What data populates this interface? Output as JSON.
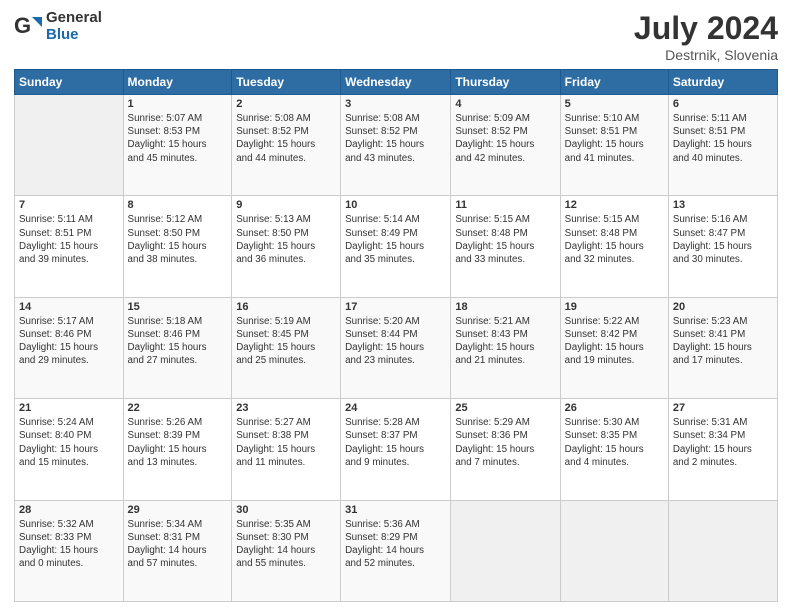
{
  "header": {
    "logo_general": "General",
    "logo_blue": "Blue",
    "month_year": "July 2024",
    "location": "Destrnik, Slovenia"
  },
  "days_of_week": [
    "Sunday",
    "Monday",
    "Tuesday",
    "Wednesday",
    "Thursday",
    "Friday",
    "Saturday"
  ],
  "weeks": [
    [
      {
        "day": "",
        "info": ""
      },
      {
        "day": "1",
        "info": "Sunrise: 5:07 AM\nSunset: 8:53 PM\nDaylight: 15 hours\nand 45 minutes."
      },
      {
        "day": "2",
        "info": "Sunrise: 5:08 AM\nSunset: 8:52 PM\nDaylight: 15 hours\nand 44 minutes."
      },
      {
        "day": "3",
        "info": "Sunrise: 5:08 AM\nSunset: 8:52 PM\nDaylight: 15 hours\nand 43 minutes."
      },
      {
        "day": "4",
        "info": "Sunrise: 5:09 AM\nSunset: 8:52 PM\nDaylight: 15 hours\nand 42 minutes."
      },
      {
        "day": "5",
        "info": "Sunrise: 5:10 AM\nSunset: 8:51 PM\nDaylight: 15 hours\nand 41 minutes."
      },
      {
        "day": "6",
        "info": "Sunrise: 5:11 AM\nSunset: 8:51 PM\nDaylight: 15 hours\nand 40 minutes."
      }
    ],
    [
      {
        "day": "7",
        "info": "Sunrise: 5:11 AM\nSunset: 8:51 PM\nDaylight: 15 hours\nand 39 minutes."
      },
      {
        "day": "8",
        "info": "Sunrise: 5:12 AM\nSunset: 8:50 PM\nDaylight: 15 hours\nand 38 minutes."
      },
      {
        "day": "9",
        "info": "Sunrise: 5:13 AM\nSunset: 8:50 PM\nDaylight: 15 hours\nand 36 minutes."
      },
      {
        "day": "10",
        "info": "Sunrise: 5:14 AM\nSunset: 8:49 PM\nDaylight: 15 hours\nand 35 minutes."
      },
      {
        "day": "11",
        "info": "Sunrise: 5:15 AM\nSunset: 8:48 PM\nDaylight: 15 hours\nand 33 minutes."
      },
      {
        "day": "12",
        "info": "Sunrise: 5:15 AM\nSunset: 8:48 PM\nDaylight: 15 hours\nand 32 minutes."
      },
      {
        "day": "13",
        "info": "Sunrise: 5:16 AM\nSunset: 8:47 PM\nDaylight: 15 hours\nand 30 minutes."
      }
    ],
    [
      {
        "day": "14",
        "info": "Sunrise: 5:17 AM\nSunset: 8:46 PM\nDaylight: 15 hours\nand 29 minutes."
      },
      {
        "day": "15",
        "info": "Sunrise: 5:18 AM\nSunset: 8:46 PM\nDaylight: 15 hours\nand 27 minutes."
      },
      {
        "day": "16",
        "info": "Sunrise: 5:19 AM\nSunset: 8:45 PM\nDaylight: 15 hours\nand 25 minutes."
      },
      {
        "day": "17",
        "info": "Sunrise: 5:20 AM\nSunset: 8:44 PM\nDaylight: 15 hours\nand 23 minutes."
      },
      {
        "day": "18",
        "info": "Sunrise: 5:21 AM\nSunset: 8:43 PM\nDaylight: 15 hours\nand 21 minutes."
      },
      {
        "day": "19",
        "info": "Sunrise: 5:22 AM\nSunset: 8:42 PM\nDaylight: 15 hours\nand 19 minutes."
      },
      {
        "day": "20",
        "info": "Sunrise: 5:23 AM\nSunset: 8:41 PM\nDaylight: 15 hours\nand 17 minutes."
      }
    ],
    [
      {
        "day": "21",
        "info": "Sunrise: 5:24 AM\nSunset: 8:40 PM\nDaylight: 15 hours\nand 15 minutes."
      },
      {
        "day": "22",
        "info": "Sunrise: 5:26 AM\nSunset: 8:39 PM\nDaylight: 15 hours\nand 13 minutes."
      },
      {
        "day": "23",
        "info": "Sunrise: 5:27 AM\nSunset: 8:38 PM\nDaylight: 15 hours\nand 11 minutes."
      },
      {
        "day": "24",
        "info": "Sunrise: 5:28 AM\nSunset: 8:37 PM\nDaylight: 15 hours\nand 9 minutes."
      },
      {
        "day": "25",
        "info": "Sunrise: 5:29 AM\nSunset: 8:36 PM\nDaylight: 15 hours\nand 7 minutes."
      },
      {
        "day": "26",
        "info": "Sunrise: 5:30 AM\nSunset: 8:35 PM\nDaylight: 15 hours\nand 4 minutes."
      },
      {
        "day": "27",
        "info": "Sunrise: 5:31 AM\nSunset: 8:34 PM\nDaylight: 15 hours\nand 2 minutes."
      }
    ],
    [
      {
        "day": "28",
        "info": "Sunrise: 5:32 AM\nSunset: 8:33 PM\nDaylight: 15 hours\nand 0 minutes."
      },
      {
        "day": "29",
        "info": "Sunrise: 5:34 AM\nSunset: 8:31 PM\nDaylight: 14 hours\nand 57 minutes."
      },
      {
        "day": "30",
        "info": "Sunrise: 5:35 AM\nSunset: 8:30 PM\nDaylight: 14 hours\nand 55 minutes."
      },
      {
        "day": "31",
        "info": "Sunrise: 5:36 AM\nSunset: 8:29 PM\nDaylight: 14 hours\nand 52 minutes."
      },
      {
        "day": "",
        "info": ""
      },
      {
        "day": "",
        "info": ""
      },
      {
        "day": "",
        "info": ""
      }
    ]
  ]
}
